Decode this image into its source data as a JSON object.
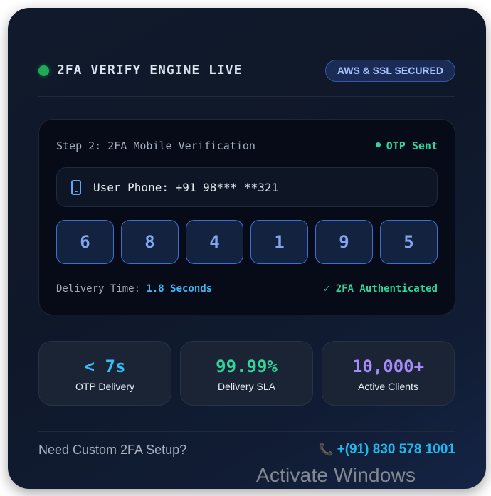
{
  "header": {
    "title": "2FA VERIFY ENGINE LIVE",
    "badge": "AWS & SSL SECURED",
    "live_indicator_color": "#22c55e"
  },
  "verification": {
    "step_title": "Step 2: 2FA Mobile Verification",
    "status": "OTP Sent",
    "phone_label": "User Phone: +91 98*** **321",
    "phone_icon": "mobile-phone-icon",
    "otp_digits": [
      "6",
      "8",
      "4",
      "1",
      "9",
      "5"
    ],
    "delivery_label": "Delivery Time:",
    "delivery_value": "1.8 Seconds",
    "auth_status": "✓ 2FA Authenticated"
  },
  "stats": [
    {
      "value": "< 7s",
      "label": "OTP Delivery",
      "color": "#38bdf8"
    },
    {
      "value": "99.99%",
      "label": "Delivery SLA",
      "color": "#34d399"
    },
    {
      "value": "10,000+",
      "label": "Active Clients",
      "color": "#a78bfa"
    }
  ],
  "footer": {
    "text": "Need Custom 2FA Setup?",
    "phone_icon": "telephone-icon",
    "phone": "+(91) 830 578 1001"
  },
  "system_watermark": "Activate Windows"
}
